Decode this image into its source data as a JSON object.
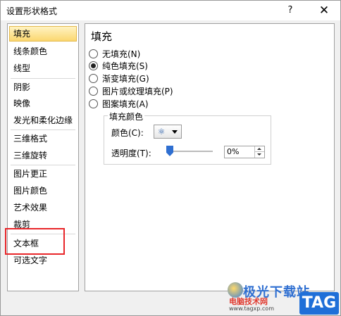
{
  "window": {
    "title": "设置形状格式",
    "help_label": "?",
    "close_label": "✕"
  },
  "nav": {
    "items": [
      {
        "label": "填充",
        "selected": true
      },
      {
        "label": "线条颜色"
      },
      {
        "label": "线型"
      },
      {
        "label": "阴影"
      },
      {
        "label": "映像"
      },
      {
        "label": "发光和柔化边缘"
      },
      {
        "label": "三维格式"
      },
      {
        "label": "三维旋转"
      },
      {
        "label": "图片更正"
      },
      {
        "label": "图片颜色"
      },
      {
        "label": "艺术效果"
      },
      {
        "label": "裁剪"
      },
      {
        "label": "文本框"
      },
      {
        "label": "可选文字"
      }
    ]
  },
  "panel": {
    "title": "填充",
    "options": [
      {
        "label": "无填充(N)",
        "checked": false
      },
      {
        "label": "纯色填充(S)",
        "checked": true
      },
      {
        "label": "渐变填充(G)",
        "checked": false
      },
      {
        "label": "图片或纹理填充(P)",
        "checked": false
      },
      {
        "label": "图案填充(A)",
        "checked": false
      }
    ],
    "fill_color": {
      "group_title": "填充颜色",
      "color_label": "颜色(C):",
      "color_icon": "paint-bucket-icon",
      "transparency_label": "透明度(T):",
      "transparency_value": "0%",
      "transparency_fraction": 0
    }
  },
  "watermark": {
    "title": "极光下载站",
    "subtitle": "电脑技术网",
    "url": "www.tagxp.com",
    "tag": "TAG"
  },
  "colors": {
    "highlight": "#e8262a",
    "selected_bg": "#fbd770",
    "slider_thumb": "#2f6fd1"
  }
}
